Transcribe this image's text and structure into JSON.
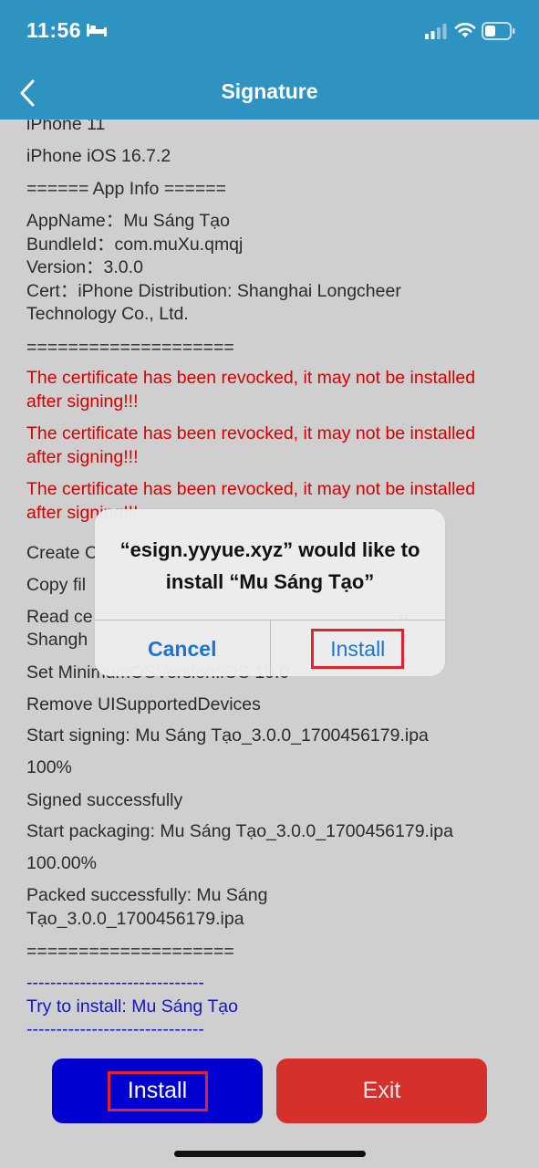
{
  "status_bar": {
    "time": "11:56",
    "icons": [
      "bed-icon",
      "cellular-signal-icon",
      "wifi-icon",
      "battery-icon"
    ]
  },
  "nav": {
    "back_icon": "chevron-left-icon",
    "title": "Signature"
  },
  "log": {
    "lines": [
      "iPhone 11",
      "iPhone iOS 16.7.2",
      "======  App Info  ======",
      "AppName：Mu Sáng Tạo\nBundleId：com.muXu.qmqj\nVersion：3.0.0\nCert：iPhone Distribution: Shanghai Longcheer Technology Co., Ltd.",
      "====================",
      "The certificate has been revocked, it may not be installed after signing!!!",
      "The certificate has been revocked, it may not be installed after signing!!!",
      "The certificate has been revocked, it may not be installed after signing!!!",
      "Create C",
      "Copy fil",
      "Read ce                                                              n:",
      "Set MinimumOSVersion:iOS 10.0",
      "Remove UISupportedDevices",
      "Start signing: Mu Sáng Tạo_3.0.0_1700456179.ipa",
      "100%",
      "Signed successfully",
      "Start packaging: Mu Sáng Tạo_3.0.0_1700456179.ipa",
      "100.00%",
      "Packed successfully: Mu Sáng Tạo_3.0.0_1700456179.ipa",
      "====================",
      "------------------------------",
      "Try to install: Mu Sáng Tạo",
      "------------------------------"
    ],
    "line_10_second": "Shangh"
  },
  "alert": {
    "title": "“esign.yyyue.xyz” would like to install “Mu Sáng Tạo”",
    "cancel_label": "Cancel",
    "install_label": "Install"
  },
  "buttons": {
    "install_label": "Install",
    "exit_label": "Exit"
  },
  "colors": {
    "nav_bar": "#2f93c2",
    "background": "#cfcfcf",
    "error_text": "#d40000",
    "install_text": "#1515c4",
    "install_button": "#0000d0",
    "exit_button": "#d5302c",
    "highlight_box": "#e0232e",
    "alert_button_text": "#1a74d8"
  }
}
